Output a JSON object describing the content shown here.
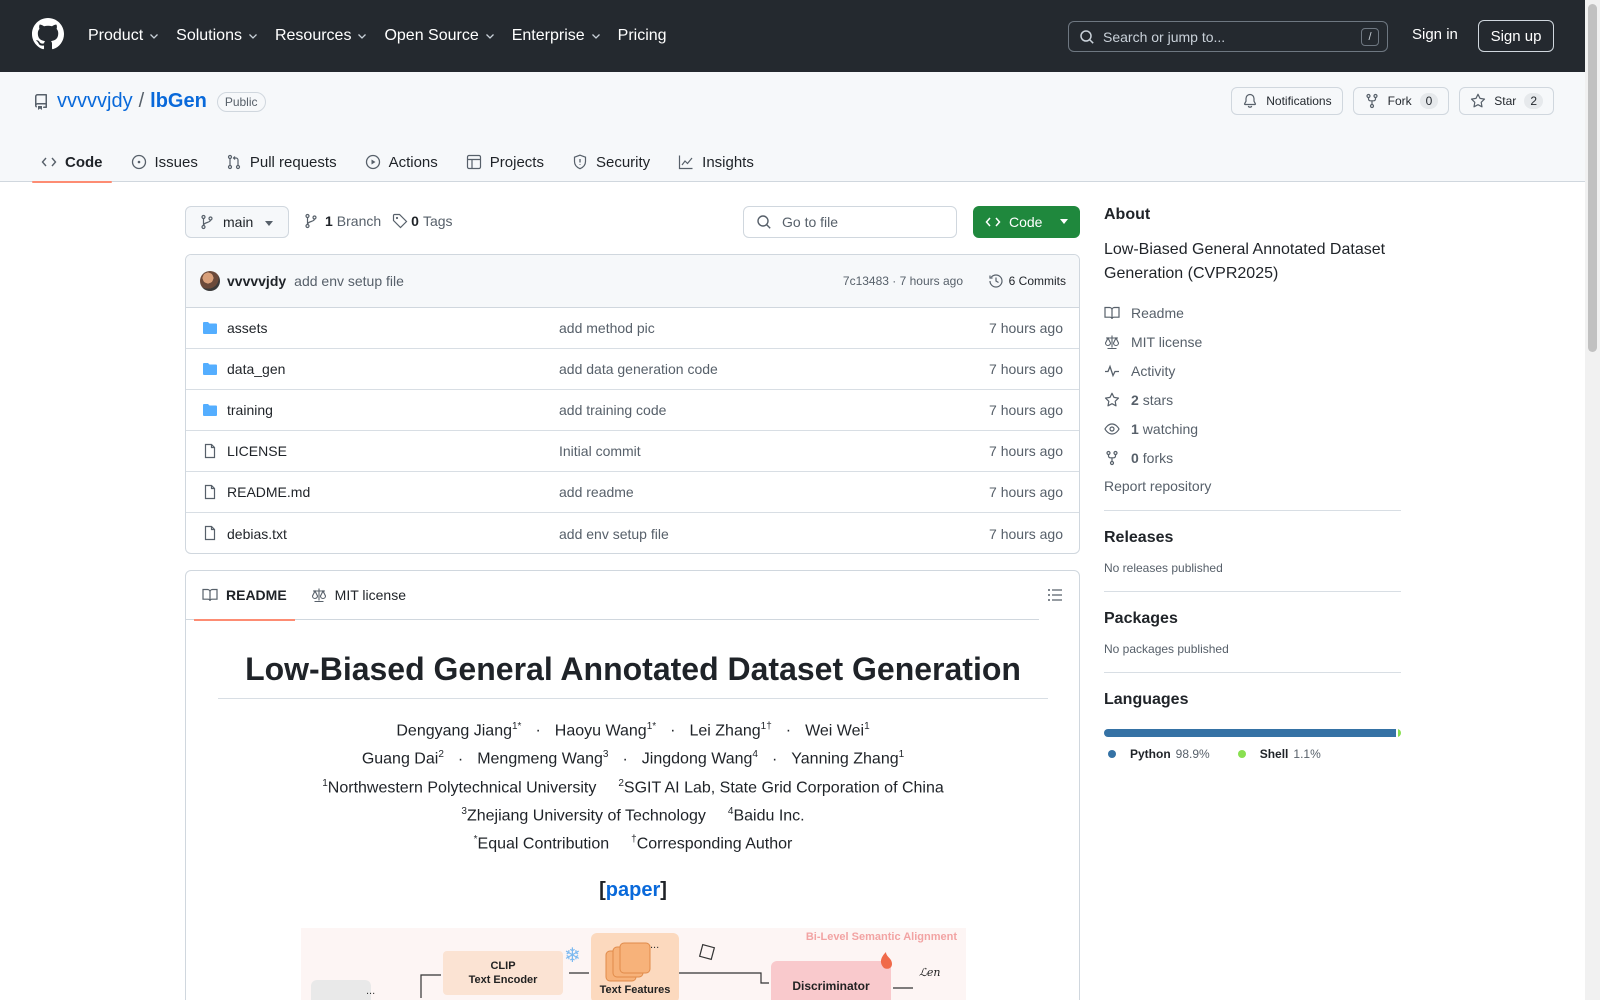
{
  "header": {
    "nav": [
      "Product",
      "Solutions",
      "Resources",
      "Open Source",
      "Enterprise",
      "Pricing"
    ],
    "search_placeholder": "Search or jump to...",
    "search_shortcut": "/",
    "signin": "Sign in",
    "signup": "Sign up"
  },
  "repo": {
    "owner": "vvvvvjdy",
    "separator": "/",
    "name": "lbGen",
    "visibility": "Public",
    "notifications": "Notifications",
    "fork_label": "Fork",
    "fork_count": "0",
    "star_label": "Star",
    "star_count": "2",
    "tabs": [
      "Code",
      "Issues",
      "Pull requests",
      "Actions",
      "Projects",
      "Security",
      "Insights"
    ]
  },
  "toolbar": {
    "branch": "main",
    "branch_count": "1",
    "branch_label": "Branch",
    "tag_count": "0",
    "tag_label": "Tags",
    "goto_placeholder": "Go to file",
    "code_button": "Code"
  },
  "commit": {
    "author": "vvvvvjdy",
    "message": "add env setup file",
    "hash_time": "7c13483 · 7 hours ago",
    "commits": "6 Commits"
  },
  "files": [
    {
      "type": "folder",
      "name": "assets",
      "message": "add method pic",
      "time": "7 hours ago"
    },
    {
      "type": "folder",
      "name": "data_gen",
      "message": "add data generation code",
      "time": "7 hours ago"
    },
    {
      "type": "folder",
      "name": "training",
      "message": "add training code",
      "time": "7 hours ago"
    },
    {
      "type": "file",
      "name": "LICENSE",
      "message": "Initial commit",
      "time": "7 hours ago"
    },
    {
      "type": "file",
      "name": "README.md",
      "message": "add readme",
      "time": "7 hours ago"
    },
    {
      "type": "file",
      "name": "debias.txt",
      "message": "add env setup file",
      "time": "7 hours ago"
    }
  ],
  "readme": {
    "tabs": [
      "README",
      "MIT license"
    ],
    "title": "Low-Biased General Annotated Dataset Generation",
    "authors_line1": [
      {
        "name": "Dengyang Jiang",
        "sup": "1*"
      },
      {
        "name": "Haoyu Wang",
        "sup": "1*"
      },
      {
        "name": "Lei Zhang",
        "sup": "1†"
      },
      {
        "name": "Wei Wei",
        "sup": "1"
      }
    ],
    "authors_line2": [
      {
        "name": "Guang Dai",
        "sup": "2"
      },
      {
        "name": "Mengmeng Wang",
        "sup": "3"
      },
      {
        "name": "Jingdong Wang",
        "sup": "4"
      },
      {
        "name": "Yanning Zhang",
        "sup": "1"
      }
    ],
    "affil_line1": [
      {
        "sup": "1",
        "name": "Northwestern Polytechnical University"
      },
      {
        "sup": "2",
        "name": "SGIT AI Lab, State Grid Corporation of China"
      }
    ],
    "affil_line2": [
      {
        "sup": "3",
        "name": "Zhejiang University of Technology"
      },
      {
        "sup": "4",
        "name": "Baidu Inc."
      }
    ],
    "notes": [
      {
        "sup": "*",
        "name": "Equal Contribution"
      },
      {
        "sup": "†",
        "name": "Corresponding Author"
      }
    ],
    "paper_open": "[",
    "paper_link": "paper",
    "paper_close": "]",
    "figure_labels": {
      "clip": "CLIP",
      "text_encoder": "Text Encoder",
      "text_features": "Text Features",
      "discriminator": "Discriminator",
      "alignment": "Bi-Level Semantic Alignment",
      "loss": "ℒen",
      "ellipsis": "..."
    }
  },
  "sidebar": {
    "about_title": "About",
    "description": "Low-Biased General Annotated Dataset Generation (CVPR2025)",
    "meta": [
      {
        "icon": "book-icon",
        "count": "",
        "label": "Readme"
      },
      {
        "icon": "law-icon",
        "count": "",
        "label": "MIT license"
      },
      {
        "icon": "pulse-icon",
        "count": "",
        "label": "Activity"
      },
      {
        "icon": "star-icon",
        "count": "2",
        "label": "stars"
      },
      {
        "icon": "eye-icon",
        "count": "1",
        "label": "watching"
      },
      {
        "icon": "fork-icon",
        "count": "0",
        "label": "forks"
      }
    ],
    "report": "Report repository",
    "releases_title": "Releases",
    "releases_text": "No releases published",
    "packages_title": "Packages",
    "packages_text": "No packages published",
    "languages_title": "Languages",
    "languages": [
      {
        "name": "Python",
        "percent": "98.9%",
        "value": 98.9,
        "color": "#3572A5"
      },
      {
        "name": "Shell",
        "percent": "1.1%",
        "value": 1.1,
        "color": "#89e051"
      }
    ]
  }
}
